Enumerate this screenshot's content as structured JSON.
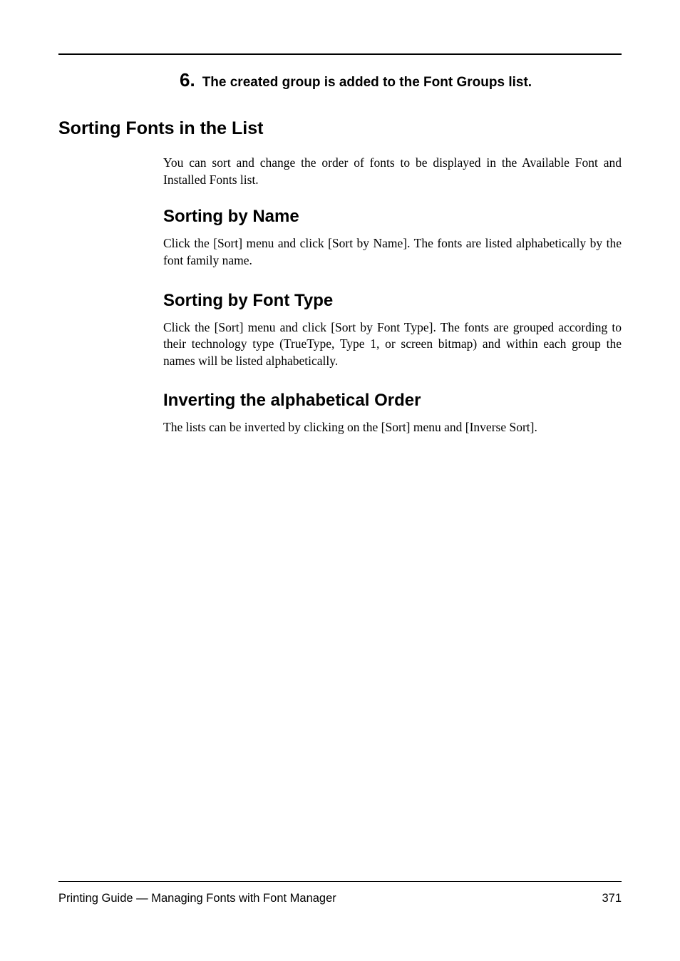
{
  "step": {
    "number": "6.",
    "text": "The created group is added to the Font Groups list."
  },
  "heading1": "Sorting Fonts in the List",
  "intro_para": "You can sort and change the order of fonts to be displayed in the Available Font and Installed Fonts list.",
  "sections": {
    "sort_name": {
      "title": "Sorting by Name",
      "body": "Click the [Sort] menu and click [Sort by Name]. The fonts are listed alphabetically by the font family name."
    },
    "sort_type": {
      "title": "Sorting by Font Type",
      "body": "Click the [Sort] menu and click [Sort by Font Type]. The fonts are grouped according to their technology type (TrueType, Type 1, or screen bitmap) and within each group the names will be listed alphabetically."
    },
    "invert": {
      "title": "Inverting the alphabetical Order",
      "body": "The lists can be inverted by clicking on the [Sort] menu and [Inverse Sort]."
    }
  },
  "footer": {
    "left": "Printing Guide — Managing Fonts with Font Manager",
    "page": "371"
  }
}
